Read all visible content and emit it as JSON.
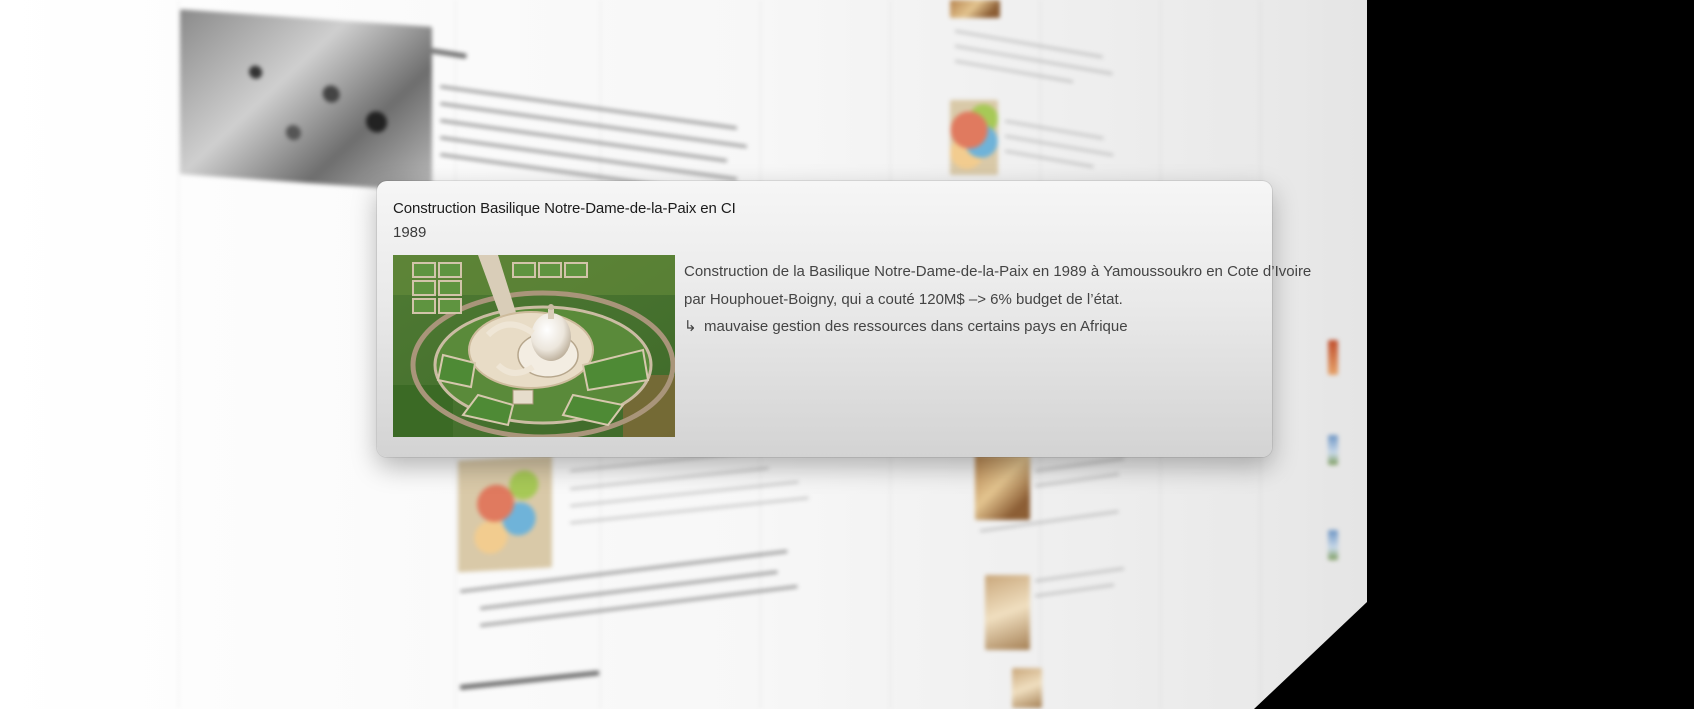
{
  "popover": {
    "title": "Construction Basilique Notre-Dame-de-la-Paix en CI",
    "year": "1989",
    "image_alt": "basilica-aerial-photo",
    "body_line_1": "Construction de la Basilique Notre-Dame-de-la-Paix en 1989 à Yamoussoukro en Cote d’Ivoire",
    "body_line_2": "par Houphouet-Boigny, qui a couté 120M$ –> 6% budget de l’état.",
    "body_line_3_arrow": "↳",
    "body_line_3": "mauvaise gestion des ressources dans certains pays en Afrique"
  },
  "colors": {
    "background": "#000000",
    "card_top": "#f6f6f6",
    "card_bottom": "#d3d3d3",
    "text": "#444444",
    "title": "#1b1b1b"
  }
}
